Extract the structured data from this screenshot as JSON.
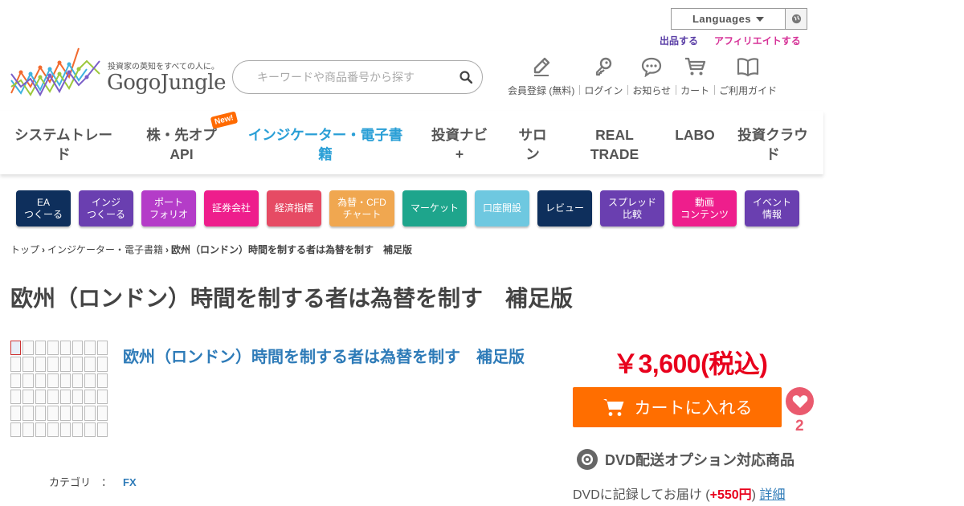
{
  "header": {
    "languages_label": "Languages",
    "sell_link": "出品する",
    "affiliate_link": "アフィリエイトする",
    "logo_tagline": "投資家の英知をすべての人に。",
    "logo_name": "GogoJungle",
    "search_placeholder": "キーワードや商品番号から探す",
    "user_nav": [
      {
        "label": "会員登録 (無料)",
        "icon": "pen-icon"
      },
      {
        "label": "ログイン",
        "icon": "key-icon"
      },
      {
        "label": "お知らせ",
        "icon": "chat-bubble-icon"
      },
      {
        "label": "カート",
        "icon": "cart-icon"
      },
      {
        "label": "ご利用ガイド",
        "icon": "book-icon"
      }
    ]
  },
  "main_nav": {
    "items": [
      {
        "label": "システムトレード",
        "l1": "システムトレー",
        "l2": "ド"
      },
      {
        "label": "株・先オプAPI",
        "l1": "株・先オプ",
        "l2": "API"
      },
      {
        "label": "インジケーター・電子書籍",
        "l1": "インジケーター・電子書",
        "l2": "籍"
      },
      {
        "label": "投資ナビ+",
        "l1": "投資ナビ",
        "l2": "+"
      },
      {
        "label": "サロン",
        "l1": "サロ",
        "l2": "ン"
      },
      {
        "label": "REAL TRADE",
        "l1": "REAL",
        "l2": "TRADE"
      },
      {
        "label": "LABO",
        "l1": "LABO",
        "l2": ""
      },
      {
        "label": "投資クラウド",
        "l1": "投資クラウ",
        "l2": "ド"
      }
    ],
    "new_badge": "New!",
    "active_color": "#2a9fd6"
  },
  "category_buttons": [
    {
      "label": "EA\nつくーる",
      "color": "#0e2f5c"
    },
    {
      "label": "インジ\nつくーる",
      "color": "#6a3fb0"
    },
    {
      "label": "ポート\nフォリオ",
      "color": "#b43cc8"
    },
    {
      "label": "証券会社",
      "color": "#ee1e8c"
    },
    {
      "label": "経済指標",
      "color": "#e64b64"
    },
    {
      "label": "為替・CFD\nチャート",
      "color": "#f0a750"
    },
    {
      "label": "マーケット",
      "color": "#1ea58c"
    },
    {
      "label": "口座開設",
      "color": "#6ec8e0"
    },
    {
      "label": "レビュー",
      "color": "#0e2f5c"
    },
    {
      "label": "スプレッド\n比較",
      "color": "#6a3fb0"
    },
    {
      "label": "動画\nコンテンツ",
      "color": "#ee1e8c"
    },
    {
      "label": "イベント\n情報",
      "color": "#6a3fb0"
    }
  ],
  "breadcrumb": {
    "items": [
      "トップ",
      "インジケーター・電子書籍"
    ],
    "current": "欧州（ロンドン）時間を制する者は為替を制す　補足版"
  },
  "product": {
    "page_title": "欧州（ロンドン）時間を制する者は為替を制す　補足版",
    "name": "欧州（ロンドン）時間を制する者は為替を制す　補足版",
    "category_label": "カテゴリ　：",
    "category_value": "FX",
    "price": "￥3,600(税込)",
    "cart_button": "カートに入れる",
    "favorite_count": "2",
    "dvd_title": "DVD配送オプション対応商品",
    "dvd_desc_prefix": "DVDに記録してお届け (",
    "dvd_desc_price": "+550円",
    "dvd_desc_suffix": ") ",
    "dvd_detail_link": "詳細"
  },
  "colors": {
    "price_red": "#e8001c",
    "cart_orange": "#ff6e00",
    "favorite_pink": "#ea5a6e",
    "link_blue": "#2e7bb8"
  }
}
